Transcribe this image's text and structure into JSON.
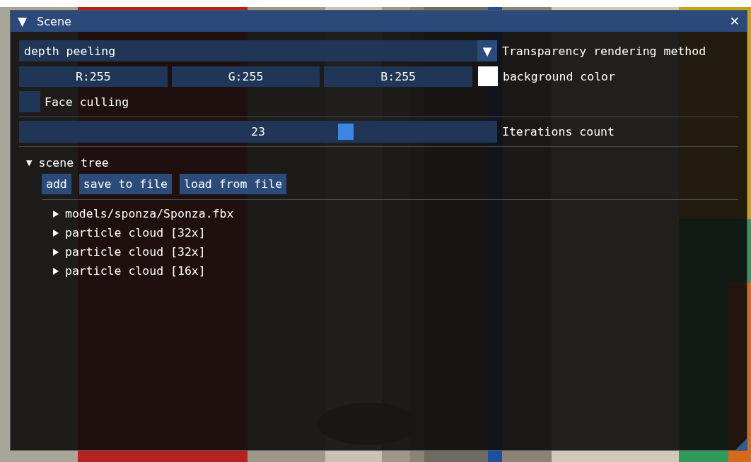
{
  "window": {
    "title": "Scene",
    "collapse_icon": "▼",
    "close_icon": "✕"
  },
  "transparency": {
    "value": "depth peeling",
    "arrow": "▼",
    "label": "Transparency rendering method"
  },
  "background_color": {
    "channels": [
      "R:255",
      "G:255",
      "B:255"
    ],
    "color": "#ffffff",
    "label": "background color"
  },
  "face_culling": {
    "label": "Face culling",
    "checked": false
  },
  "iterations": {
    "value": "23",
    "level": 0.69,
    "label": "Iterations count"
  },
  "scene_tree": {
    "label": "scene tree",
    "expanded": true,
    "buttons": [
      "add",
      "save to file",
      "load from file"
    ],
    "items": [
      {
        "label": "models/sponza/Sponza.fbx",
        "expanded": false
      },
      {
        "label": "particle cloud [32x]",
        "expanded": false
      },
      {
        "label": "particle cloud [32x]",
        "expanded": false
      },
      {
        "label": "particle cloud [16x]",
        "expanded": false
      }
    ]
  }
}
